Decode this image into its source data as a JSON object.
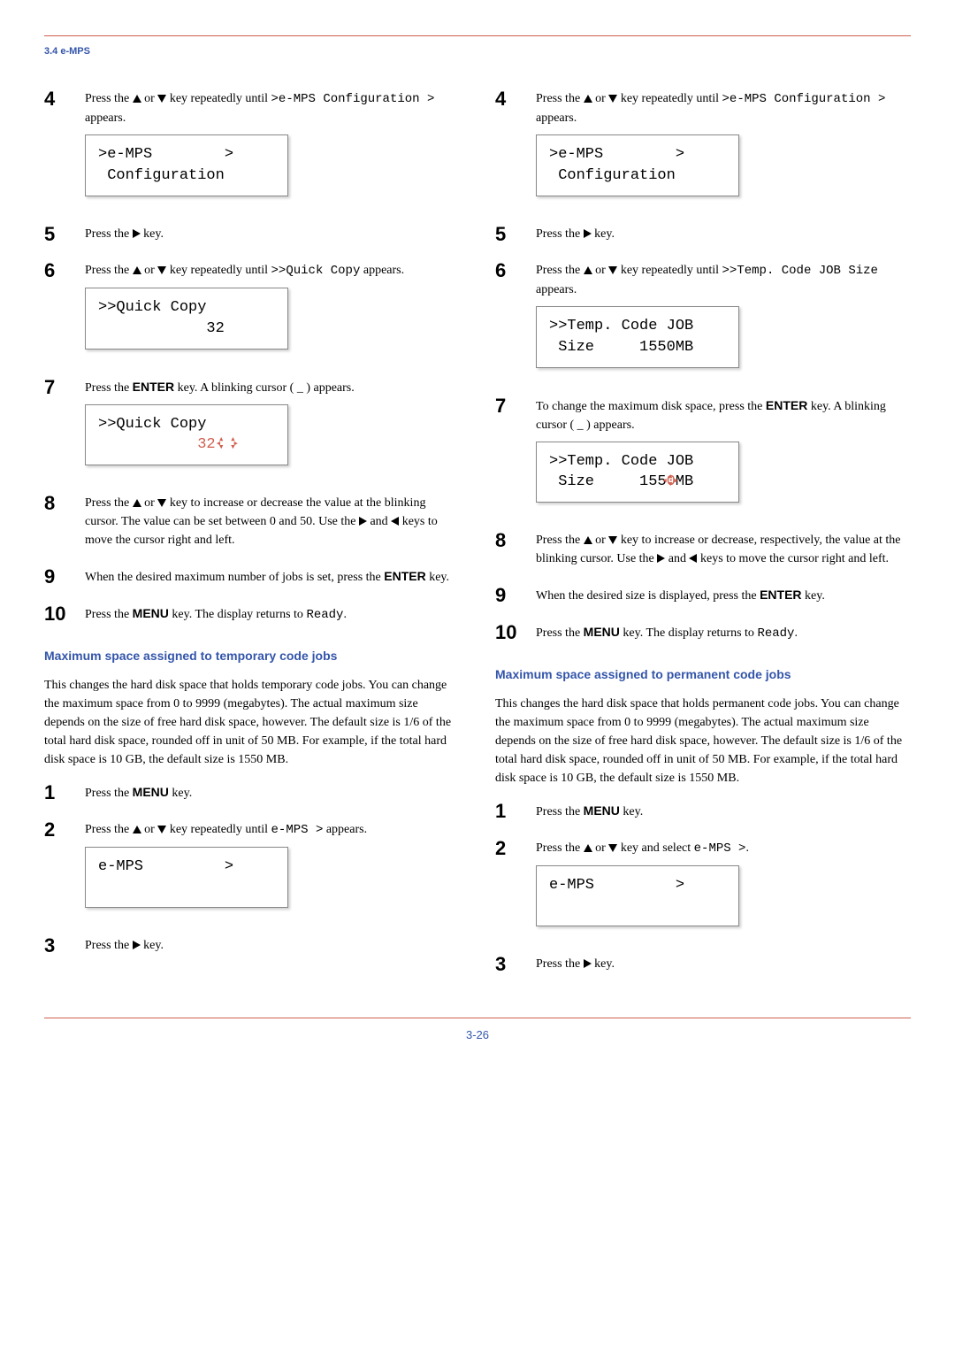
{
  "header": {
    "section": "3.4 e-MPS"
  },
  "left": {
    "s4": {
      "before": "Press the ",
      "mid1": " or ",
      "mid2": " key repeatedly until ",
      "code": ">e-MPS Configuration >",
      "after": " appears."
    },
    "lcd4": ">e-MPS        >\n Configuration",
    "s5": {
      "before": "Press the ",
      "after": " key."
    },
    "s6": {
      "before": "Press the ",
      "mid1": " or ",
      "mid2": " key repeatedly until ",
      "code": ">>Quick Copy",
      "after": " appears."
    },
    "lcd6": ">>Quick Copy\n            32",
    "s7": {
      "before": "Press the ",
      "enter": "ENTER",
      "after": " key. A blinking cursor ( _ ) appears."
    },
    "lcd7_prefix": ">>Quick Copy\n           ",
    "lcd7_blink": "32",
    "s8": {
      "before": "Press the ",
      "mid1": " or ",
      "mid2": " key to increase or decrease the value at the blinking cursor. The value can be set between 0 and 50. Use the ",
      "mid3": " and ",
      "after": " keys to move the cursor right and left."
    },
    "s9": {
      "before": "When the desired maximum number of jobs is set, press the ",
      "enter": "ENTER",
      "after": " key."
    },
    "s10": {
      "before": "Press the ",
      "menu": "MENU",
      "mid": " key. The display returns to ",
      "code": "Ready",
      "after": "."
    },
    "h1": "Maximum space assigned to temporary code jobs",
    "p1": "This changes the hard disk space that holds temporary code jobs. You can change the maximum space from 0 to 9999 (megabytes). The actual maximum size depends on the size of free hard disk space, however. The default size is 1/6 of the total hard disk space, rounded off in unit of 50 MB. For example, if the total hard disk space is 10 GB, the default size is 1550 MB.",
    "s1b": {
      "before": "Press the ",
      "menu": "MENU",
      "after": " key."
    },
    "s2b": {
      "before": "Press the ",
      "mid1": " or ",
      "mid2": " key repeatedly until ",
      "code": "e-MPS >",
      "after": " appears."
    },
    "lcd2b": "e-MPS         >\n ",
    "s3b": {
      "before": "Press the ",
      "after": " key."
    }
  },
  "right": {
    "s4": {
      "before": "Press the ",
      "mid1": " or ",
      "mid2": " key repeatedly until ",
      "code": ">e-MPS Configuration >",
      "after": " appears."
    },
    "lcd4": ">e-MPS        >\n Configuration",
    "s5": {
      "before": "Press the ",
      "after": " key."
    },
    "s6": {
      "before": "Press the ",
      "mid1": " or ",
      "mid2": " key repeatedly until ",
      "code": ">>Temp. Code JOB Size",
      "after": " appears."
    },
    "lcd6": ">>Temp. Code JOB\n Size     1550MB",
    "s7": {
      "before": "To change the maximum disk space, press the ",
      "enter": "ENTER",
      "after": " key. A blinking cursor ( _ ) appears."
    },
    "lcd7_prefix": ">>Temp. Code JOB\n Size     155",
    "lcd7_blink": "0",
    "lcd7_suffix": "MB",
    "s8": {
      "before": "Press the ",
      "mid1": " or ",
      "mid2": " key to increase or decrease, respectively, the value at the blinking cursor. Use the ",
      "mid3": " and ",
      "after": " keys to move the cursor right and left."
    },
    "s9": {
      "before": "When the desired size is displayed, press the ",
      "enter": "ENTER",
      "after": " key."
    },
    "s10": {
      "before": "Press the ",
      "menu": "MENU",
      "mid": " key. The display returns to ",
      "code": "Ready",
      "after": "."
    },
    "h1": "Maximum space assigned to permanent code jobs",
    "p1": "This changes the hard disk space that holds permanent code jobs. You can change the maximum space from 0 to 9999 (megabytes). The actual maximum size depends on the size of free hard disk space, however. The default size is 1/6 of the total hard disk space, rounded off in unit of 50 MB. For example, if the total hard disk space is 10 GB, the default size is 1550 MB.",
    "s1b": {
      "before": "Press the ",
      "menu": "MENU",
      "after": " key."
    },
    "s2b": {
      "before": "Press the ",
      "mid1": " or ",
      "mid2": " key and select ",
      "code": "e-MPS >",
      "after": "."
    },
    "lcd2b": "e-MPS         >\n ",
    "s3b": {
      "before": "Press the ",
      "after": " key."
    }
  },
  "footer": {
    "page": "3-26"
  }
}
